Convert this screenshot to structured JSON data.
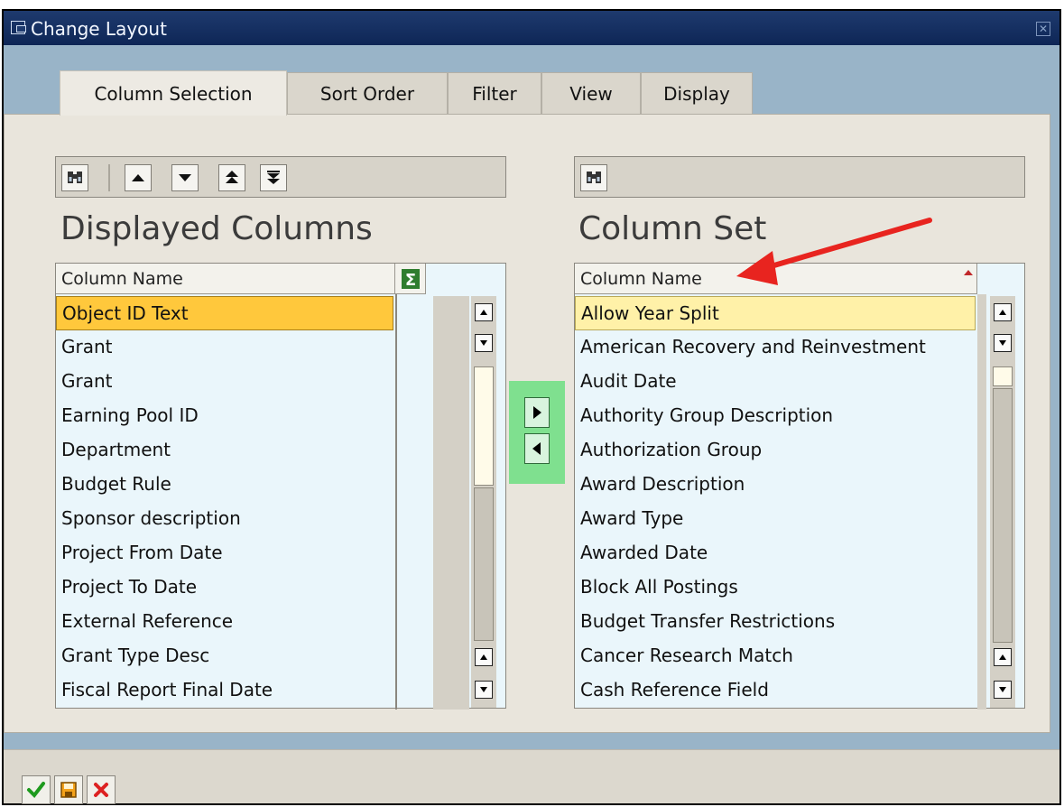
{
  "window": {
    "title": "Change Layout"
  },
  "tabs": [
    {
      "label": "Column Selection",
      "active": true
    },
    {
      "label": "Sort Order",
      "active": false
    },
    {
      "label": "Filter",
      "active": false
    },
    {
      "label": "View",
      "active": false
    },
    {
      "label": "Display",
      "active": false
    }
  ],
  "displayed": {
    "title": "Displayed Columns",
    "header": "Column Name",
    "rows": [
      "Object ID Text",
      "Grant",
      "Grant",
      "Earning Pool ID",
      "Department",
      "Budget Rule",
      "Sponsor description",
      "Project From Date",
      "Project To Date",
      "External Reference",
      "Grant Type Desc",
      "Fiscal Report Final Date"
    ]
  },
  "column_set": {
    "title": "Column Set",
    "header": "Column Name",
    "rows": [
      "Allow Year Split",
      "American Recovery and Reinvestment",
      "Audit Date",
      "Authority Group Description",
      "Authorization Group",
      "Award Description",
      "Award Type",
      "Awarded Date",
      "Block All Postings",
      "Budget Transfer Restrictions",
      "Cancer Research Match",
      "Cash Reference Field"
    ]
  },
  "colors": {
    "accent_selected": "#ffc83c",
    "selected_light": "#fff1a8",
    "transfer_highlight": "#7fe08f",
    "annotation_arrow": "#e8241f"
  },
  "icons": [
    "find-icon",
    "move-up-icon",
    "move-down-icon",
    "move-top-icon",
    "move-bottom-icon",
    "sum-icon",
    "transfer-right-icon",
    "transfer-left-icon",
    "confirm-icon",
    "save-icon",
    "cancel-icon"
  ]
}
